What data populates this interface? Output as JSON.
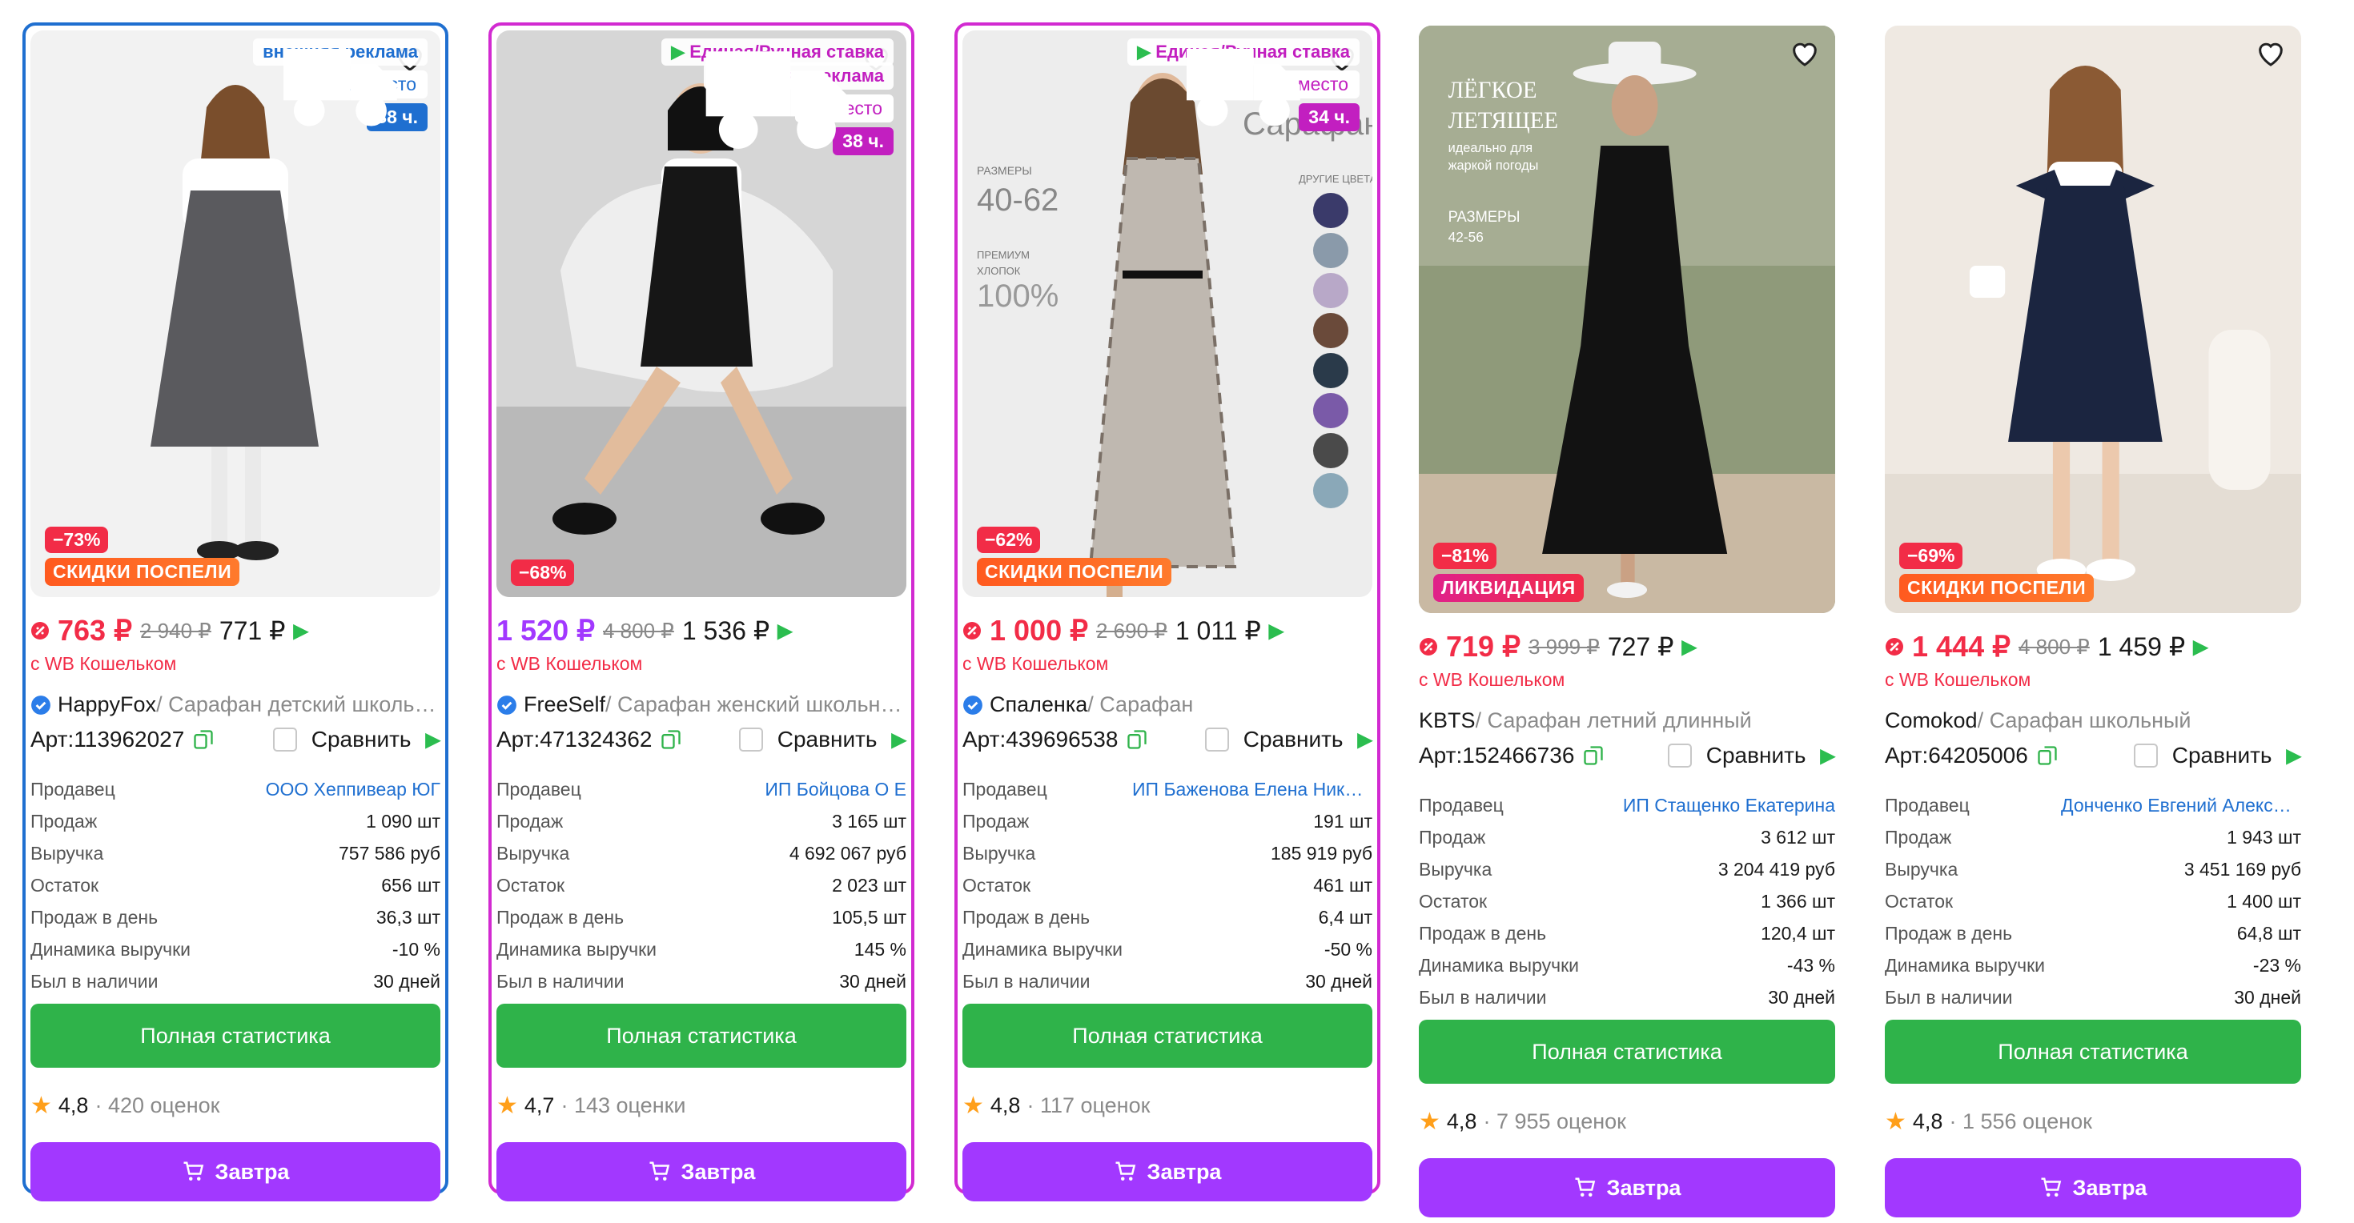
{
  "colors": {
    "price_red": "#f22c47",
    "price_violet": "#a238ff",
    "ad_blue": "#1f6fd0",
    "ad_pink": "#c21fc0",
    "stat_green": "#2fb34a",
    "buy_violet": "#a238ff"
  },
  "stat_labels": {
    "seller": "Продавец",
    "sales": "Продаж",
    "revenue": "Выручка",
    "stock": "Остаток",
    "per_day": "Продаж в день",
    "dynamics": "Динамика выручки",
    "in_stock_days": "Был в наличии"
  },
  "ui": {
    "compare_label": "Сравнить",
    "stats_button": "Полная статистика",
    "buy_button": "Завтра",
    "wallet_note": "с WB Кошельком",
    "art_prefix": "Арт: "
  },
  "cards": [
    {
      "ad": {
        "line1": "внешняя реклама",
        "line2": "",
        "place": "11 место",
        "delivery": "38 ч."
      },
      "discount": "−73%",
      "promo": "СКИДКИ ПОСПЕЛИ",
      "price": "763 ₽",
      "price_old": "2 940 ₽",
      "price_alt": "771 ₽",
      "brand": "HappyFox",
      "title": " / Сарафан детский школьный",
      "art": "113962027",
      "seller": "ООО Хеппивеар ЮГ",
      "sales": "1 090 шт",
      "revenue": "757 586 руб",
      "stock": "656 шт",
      "per_day": "36,3 шт",
      "dynamics": "-10 %",
      "in_stock_days": "30 дней",
      "rating": "4,8",
      "reviews": "· 420 оценок"
    },
    {
      "ad": {
        "line1": "Единая/Ручная ставка",
        "line2": "+ внешняя реклама",
        "place": "12 место",
        "delivery": "38 ч."
      },
      "discount": "−68%",
      "promo": "",
      "price": "1 520 ₽",
      "price_old": "4 800 ₽",
      "price_alt": "1 536 ₽",
      "brand": "FreeSelf",
      "title": " / Сарафан женский школьный",
      "art": "471324362",
      "seller": "ИП Бойцова О Е",
      "sales": "3 165 шт",
      "revenue": "4 692 067 руб",
      "stock": "2 023 шт",
      "per_day": "105,5 шт",
      "dynamics": "145 %",
      "in_stock_days": "30 дней",
      "rating": "4,7",
      "reviews": "· 143 оценки"
    },
    {
      "ad": {
        "line1": "Единая/Ручная ставка",
        "line2": "",
        "place": "13 место",
        "delivery": "34 ч."
      },
      "discount": "−62%",
      "promo": "СКИДКИ ПОСПЕЛИ",
      "price": "1 000 ₽",
      "price_old": "2 690 ₽",
      "price_alt": "1 011 ₽",
      "brand": "Спаленка",
      "title": " / Сарафан",
      "art": "439696538",
      "seller": "ИП Баженова Елена Николаевна",
      "sales": "191 шт",
      "revenue": "185 919 руб",
      "stock": "461 шт",
      "per_day": "6,4 шт",
      "dynamics": "-50 %",
      "in_stock_days": "30 дней",
      "rating": "4,8",
      "reviews": "· 117 оценок",
      "photo_text": {
        "sizes_label": "РАЗМЕРЫ",
        "sizes": "40-62",
        "premium": "ПРЕМИУМ",
        "cotton": "ХЛОПОК",
        "percent": "100%",
        "other_colors": "ДРУГИЕ ЦВЕТА",
        "name": "Сарафан"
      }
    },
    {
      "ad": null,
      "discount": "−81%",
      "promo": "ЛИКВИДАЦИЯ",
      "price": "719 ₽",
      "price_old": "3 999 ₽",
      "price_alt": "727 ₽",
      "brand": "KBTS",
      "title": " / Сарафан летний длинный",
      "art": "152466736",
      "seller": "ИП Стащенко Екатерина",
      "sales": "3 612 шт",
      "revenue": "3 204 419 руб",
      "stock": "1 366 шт",
      "per_day": "120,4 шт",
      "dynamics": "-43 %",
      "in_stock_days": "30 дней",
      "rating": "4,8",
      "reviews": "· 7 955 оценок",
      "photo_text": {
        "line1": "ЛЁГКОЕ",
        "line2": "ЛЕТЯЩЕЕ",
        "line3": "идеально для",
        "line4": "жаркой погоды",
        "sizes_label": "РАЗМЕРЫ",
        "sizes": "42-56"
      }
    },
    {
      "ad": null,
      "discount": "−69%",
      "promo": "СКИДКИ ПОСПЕЛИ",
      "price": "1 444 ₽",
      "price_old": "4 800 ₽",
      "price_alt": "1 459 ₽",
      "brand": "Comokod",
      "title": " / Сарафан школьный",
      "art": "64205006",
      "seller": "Донченко Евгений Александрович",
      "sales": "1 943 шт",
      "revenue": "3 451 169 руб",
      "stock": "1 400 шт",
      "per_day": "64,8 шт",
      "dynamics": "-23 %",
      "in_stock_days": "30 дней",
      "rating": "4,8",
      "reviews": "· 1 556 оценок"
    }
  ]
}
